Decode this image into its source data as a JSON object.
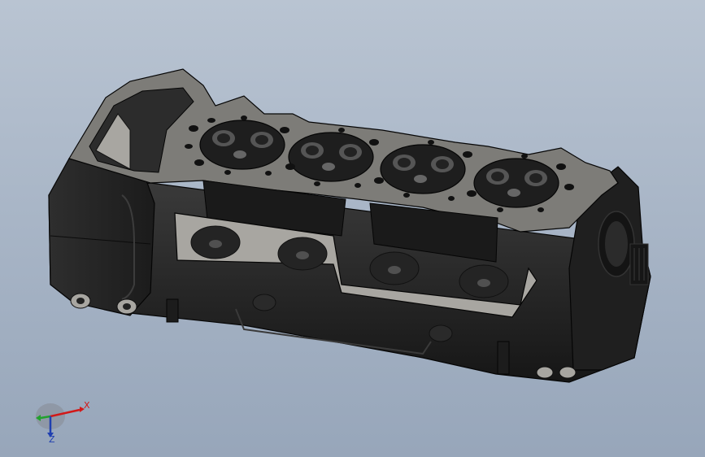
{
  "window": {
    "title": ""
  },
  "viewport": {
    "background_top": "#b9c4d2",
    "background_bottom": "#97a6ba",
    "model": {
      "label": "cylinder-head",
      "body_color": "#262626",
      "deck_face_color": "#7d7c78",
      "machined_face_color": "#a8a6a1",
      "edge_color": "#050505"
    }
  },
  "triad": {
    "x_label": "X",
    "y_label": "",
    "z_label": "Z",
    "x_color": "#d21818",
    "y_color": "#22a12e",
    "z_color": "#1f3fb0"
  }
}
